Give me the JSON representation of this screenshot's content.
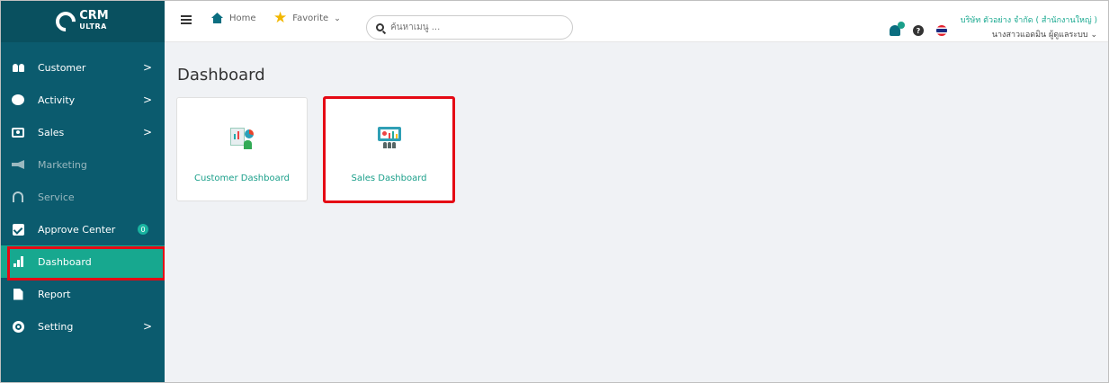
{
  "app": {
    "logo_text": "CRM",
    "logo_sub": "ULTRA"
  },
  "sidebar": {
    "items": [
      {
        "label": "Customer",
        "icon": "users-icon",
        "chevron": ">"
      },
      {
        "label": "Activity",
        "icon": "chat-icon",
        "chevron": ">"
      },
      {
        "label": "Sales",
        "icon": "sales-icon",
        "chevron": ">"
      },
      {
        "label": "Marketing",
        "icon": "megaphone-icon"
      },
      {
        "label": "Service",
        "icon": "headset-icon"
      },
      {
        "label": "Approve Center",
        "icon": "check-square-icon",
        "badge": "0"
      },
      {
        "label": "Dashboard",
        "icon": "bar-chart-icon",
        "active": true
      },
      {
        "label": "Report",
        "icon": "file-icon"
      },
      {
        "label": "Setting",
        "icon": "gear-icon",
        "chevron": ">"
      }
    ]
  },
  "topbar": {
    "home_label": "Home",
    "favorite_label": "Favorite",
    "favorite_caret": "⌄",
    "search_placeholder": "ค้นหาเมนู ...",
    "company": "บริษัท ตัวอย่าง จำกัด ( สำนักงานใหญ่ )",
    "user": "นางสาวแอดมิน ผู้ดูแลระบบ",
    "user_caret": "⌄",
    "help_glyph": "?"
  },
  "main": {
    "title": "Dashboard",
    "cards": [
      {
        "label": "Customer Dashboard",
        "icon": "customer-dashboard-icon"
      },
      {
        "label": "Sales Dashboard",
        "icon": "sales-dashboard-icon",
        "highlighted": true
      }
    ]
  },
  "colors": {
    "sidebar_bg": "#0b5b6e",
    "accent": "#17a88f",
    "highlight_border": "#e50914"
  }
}
